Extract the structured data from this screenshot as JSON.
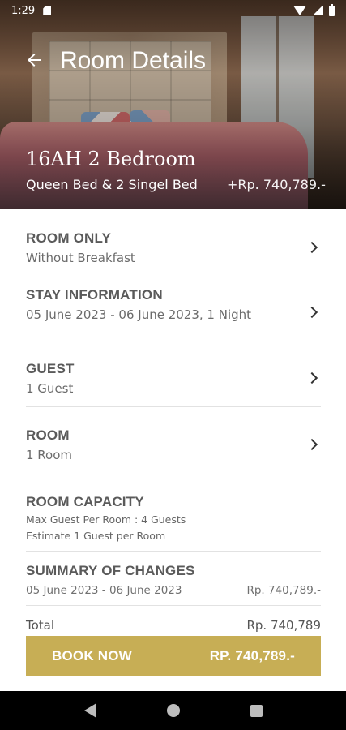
{
  "status_bar": {
    "time": "1:29",
    "icons": [
      "sd-card-icon",
      "wifi-icon",
      "signal-icon",
      "battery-icon"
    ]
  },
  "header": {
    "title": "Room Details",
    "back_icon": "arrow-left-icon"
  },
  "hero": {
    "room_name": "16AH 2 Bedroom",
    "bed_type": "Queen Bed & 2 Singel Bed",
    "overlay_text": "+Rp. 740,789.-"
  },
  "sections": {
    "room_only": {
      "title": "ROOM ONLY",
      "value": "Without Breakfast"
    },
    "stay_information": {
      "title": "STAY INFORMATION",
      "value": "05 June 2023 - 06 June 2023, 1 Night"
    },
    "guest": {
      "title": "GUEST",
      "value": "1 Guest"
    },
    "room": {
      "title": "ROOM",
      "value": "1 Room"
    },
    "room_capacity": {
      "title": "ROOM CAPACITY",
      "line1": "Max Guest Per Room : 4 Guests",
      "line2": "Estimate 1 Guest per Room"
    },
    "summary": {
      "title": "SUMMARY OF CHANGES",
      "date_range": "05 June 2023 - 06 June 2023",
      "amount": "Rp. 740,789.-"
    },
    "total": {
      "label": "Total",
      "amount": "Rp. 740,789"
    }
  },
  "book_button": {
    "label": "BOOK NOW",
    "price": "RP. 740,789.-"
  },
  "colors": {
    "accent": "#c7ae55",
    "title_text": "#5a5a5a",
    "value_text": "#6b6b6b"
  },
  "nav_bar": {
    "icons": [
      "back-triangle-icon",
      "home-circle-icon",
      "recents-square-icon"
    ]
  }
}
